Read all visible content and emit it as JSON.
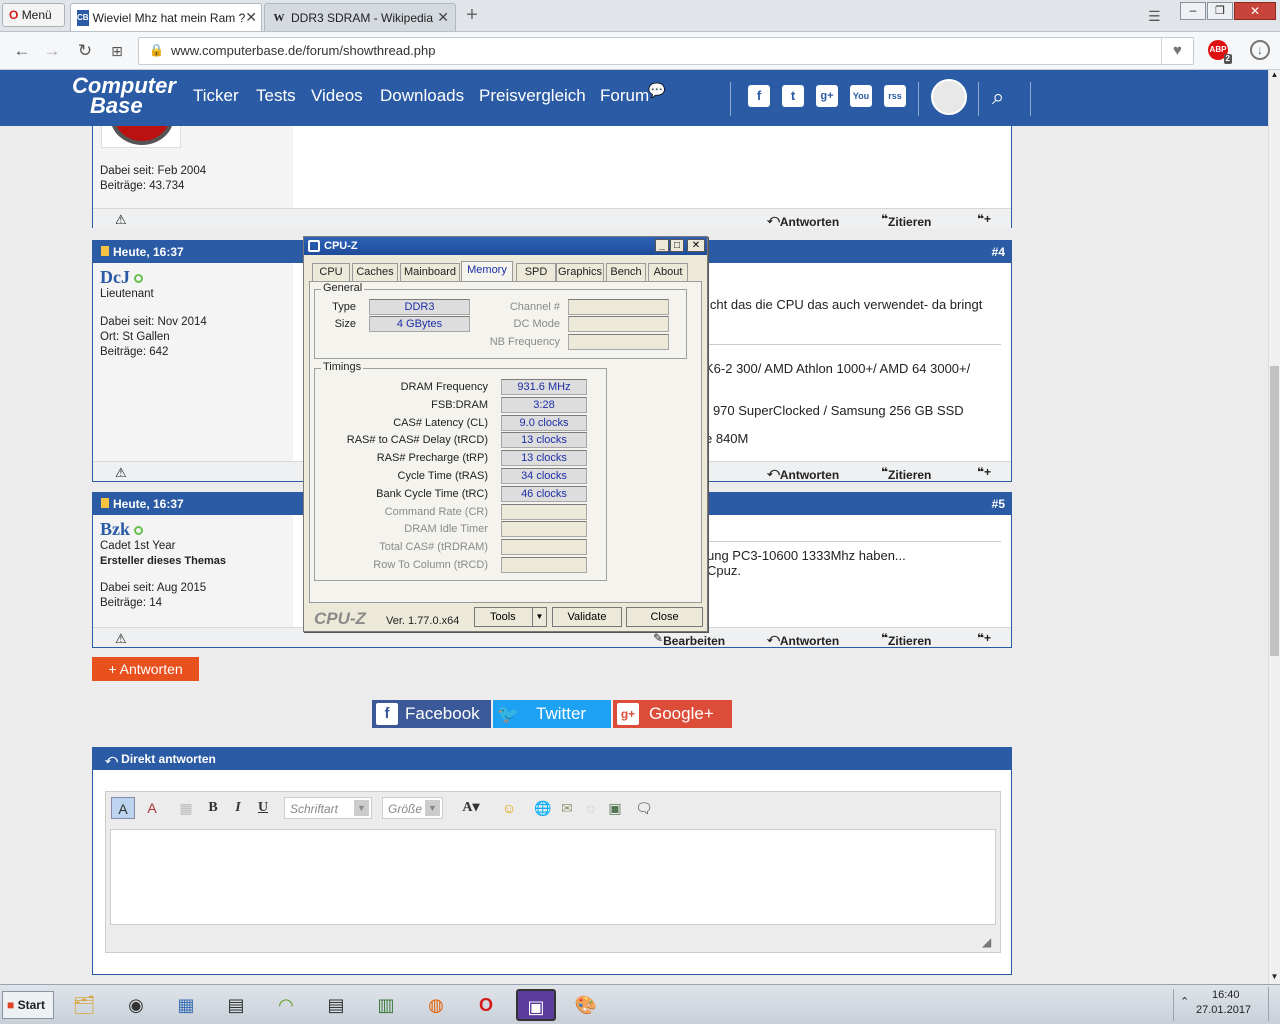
{
  "browser": {
    "menu_label": "Menü",
    "tabs": [
      {
        "label": "Wieviel Mhz hat mein Ram ?",
        "favicon": "CB"
      },
      {
        "label": "DDR3 SDRAM - Wikipedia",
        "favicon": "W"
      }
    ],
    "new_tab": "+",
    "url": "www.computerbase.de/forum/showthread.php",
    "adblock_badge": "2"
  },
  "site": {
    "logo_line1": "Computer",
    "logo_line2": "Base",
    "nav": [
      "Ticker",
      "Tests",
      "Videos",
      "Downloads",
      "Preisvergleich",
      "Forum"
    ],
    "social_icons": [
      "f",
      "t",
      "g+",
      "You",
      "rss"
    ]
  },
  "posts": {
    "p3": {
      "since": "Dabei seit: Feb 2004",
      "count": "Beiträge: 43.734",
      "reply": "Antworten",
      "quote": "Zitieren"
    },
    "p4": {
      "date": "Heute, 16:37",
      "num": "#4",
      "user": "DcJ",
      "rank": "Lieutenant",
      "since": "Dabei seit: Nov 2014",
      "location": "Ort: St Gallen",
      "count": "Beiträge: 642",
      "text1": "icht das die CPU das auch verwendet- da bringt",
      "text2": "K6-2 300/ AMD Athlon 1000+/ AMD 64 3000+/",
      "text3": "( 970 SuperClocked / Samsung 256 GB SSD",
      "text4": "e 840M",
      "reply": "Antworten",
      "quote": "Zitieren"
    },
    "p5": {
      "date": "Heute, 16:37",
      "num": "#5",
      "user": "Bzk",
      "rank": "Cadet 1st Year",
      "badge": "Ersteller dieses Themas",
      "since": "Dabei seit: Aug 2015",
      "count": "Beiträge: 14",
      "text1": "ung PC3-10600 1333Mhz haben...",
      "text2": "Cpuz.",
      "edit": "Bearbeiten",
      "reply": "Antworten",
      "quote": "Zitieren"
    }
  },
  "reply_button": "Antworten",
  "share": {
    "facebook": "Facebook",
    "twitter": "Twitter",
    "googleplus": "Google+"
  },
  "direct_reply": {
    "title": "Direkt antworten",
    "font_placeholder": "Schriftart",
    "size_placeholder": "Größe",
    "bold": "B",
    "italic": "I",
    "underline": "U",
    "color": "A"
  },
  "cpuz": {
    "title": "CPU-Z",
    "tabs": [
      "CPU",
      "Caches",
      "Mainboard",
      "Memory",
      "SPD",
      "Graphics",
      "Bench",
      "About"
    ],
    "general_label": "General",
    "type_label": "Type",
    "type_value": "DDR3",
    "size_label": "Size",
    "size_value": "4 GBytes",
    "channel_label": "Channel #",
    "dcmode_label": "DC Mode",
    "nbfreq_label": "NB Frequency",
    "timings_label": "Timings",
    "timings": [
      {
        "label": "DRAM Frequency",
        "value": "931.6 MHz"
      },
      {
        "label": "FSB:DRAM",
        "value": "3:28"
      },
      {
        "label": "CAS# Latency (CL)",
        "value": "9.0 clocks"
      },
      {
        "label": "RAS# to CAS# Delay (tRCD)",
        "value": "13 clocks"
      },
      {
        "label": "RAS# Precharge (tRP)",
        "value": "13 clocks"
      },
      {
        "label": "Cycle Time (tRAS)",
        "value": "34 clocks"
      },
      {
        "label": "Bank Cycle Time (tRC)",
        "value": "46 clocks"
      },
      {
        "label": "Command Rate (CR)",
        "value": ""
      },
      {
        "label": "DRAM Idle Timer",
        "value": ""
      },
      {
        "label": "Total CAS# (tRDRAM)",
        "value": ""
      },
      {
        "label": "Row To Column (tRCD)",
        "value": ""
      }
    ],
    "brand": "CPU-Z",
    "version": "Ver. 1.77.0.x64",
    "tools": "Tools",
    "validate": "Validate",
    "close": "Close"
  },
  "taskbar": {
    "start": "Start",
    "time": "16:40",
    "date": "27.01.2017"
  },
  "colors": {
    "brand": "#2b5ba4",
    "accent": "#e8501e"
  }
}
